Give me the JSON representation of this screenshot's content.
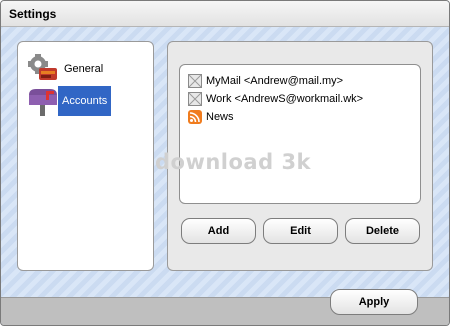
{
  "window": {
    "title": "Settings"
  },
  "nav": {
    "items": [
      {
        "label": "General",
        "icon": "gear-tools-icon",
        "selected": false
      },
      {
        "label": "Accounts",
        "icon": "mailbox-icon",
        "selected": true
      }
    ]
  },
  "accounts": [
    {
      "label": "MyMail <Andrew@mail.my>",
      "icon": "mail-account-icon"
    },
    {
      "label": "Work <AndrewS@workmail.wk>",
      "icon": "mail-account-icon"
    },
    {
      "label": "News",
      "icon": "rss-icon"
    }
  ],
  "buttons": {
    "add": "Add",
    "edit": "Edit",
    "delete": "Delete",
    "apply": "Apply"
  },
  "watermark": "download 3k",
  "colors": {
    "selection": "#3166c5",
    "rss": "#f07c1e"
  }
}
